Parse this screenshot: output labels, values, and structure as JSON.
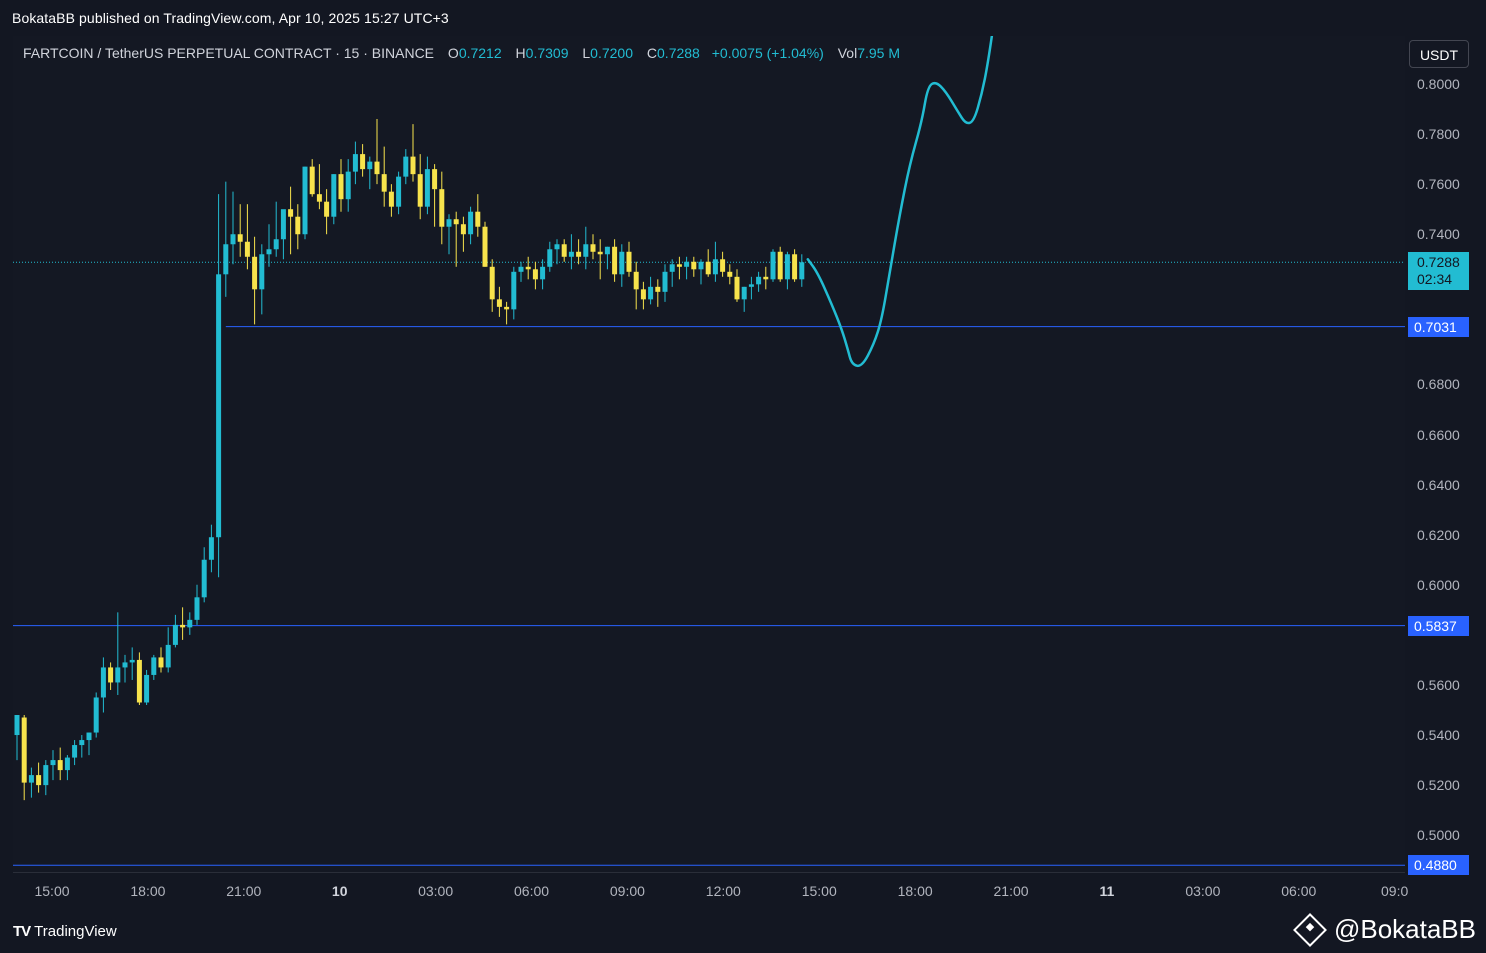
{
  "publisher_line": "BokataBB published on TradingView.com, Apr 10, 2025 15:27 UTC+3",
  "legend": {
    "symbol": "FARTCOIN / TetherUS PERPETUAL CONTRACT · 15 · BINANCE",
    "o_label": "O",
    "o_value": "0.7212",
    "h_label": "H",
    "h_value": "0.7309",
    "l_label": "L",
    "l_value": "0.7200",
    "c_label": "C",
    "c_value": "0.7288",
    "change": "+0.0075 (+1.04%)",
    "vol_label": "Vol",
    "vol_value": "7.95 M"
  },
  "currency": "USDT",
  "current_price": {
    "value": "0.7288",
    "countdown": "02:34"
  },
  "level_tags": [
    "0.7031",
    "0.5837",
    "0.4880"
  ],
  "y_axis_labels": [
    "0.8000",
    "0.7800",
    "0.7600",
    "0.7400",
    "0.6800",
    "0.6600",
    "0.6400",
    "0.6200",
    "0.6000",
    "0.5600",
    "0.5400",
    "0.5200",
    "0.5000"
  ],
  "x_axis_labels": [
    {
      "text": "15:00",
      "bold": false
    },
    {
      "text": "18:00",
      "bold": false
    },
    {
      "text": "21:00",
      "bold": false
    },
    {
      "text": "10",
      "bold": true
    },
    {
      "text": "03:00",
      "bold": false
    },
    {
      "text": "06:00",
      "bold": false
    },
    {
      "text": "09:00",
      "bold": false
    },
    {
      "text": "12:00",
      "bold": false
    },
    {
      "text": "15:00",
      "bold": false
    },
    {
      "text": "18:00",
      "bold": false
    },
    {
      "text": "21:00",
      "bold": false
    },
    {
      "text": "11",
      "bold": true
    },
    {
      "text": "03:00",
      "bold": false
    },
    {
      "text": "06:00",
      "bold": false
    },
    {
      "text": "09:0",
      "bold": false
    }
  ],
  "footer": {
    "brand": "TradingView",
    "watermark": "@BokataBB"
  },
  "colors": {
    "up": "#22bcd2",
    "down": "#f7e34c",
    "level_line": "#2962ff",
    "projection": "#22bcd2",
    "background": "#131722"
  },
  "chart_data": {
    "type": "candlestick",
    "timeframe_minutes": 15,
    "ylim": [
      0.475,
      0.82
    ],
    "levels": [
      {
        "value": 0.7031,
        "from_time": "Apr 9 21:00"
      },
      {
        "value": 0.5837,
        "from_time": "start"
      },
      {
        "value": 0.488,
        "from_time": "start"
      }
    ],
    "current_price": 0.7288,
    "candles_ohlc": [
      [
        0.54,
        0.548,
        0.53,
        0.548
      ],
      [
        0.547,
        0.548,
        0.514,
        0.521
      ],
      [
        0.521,
        0.527,
        0.515,
        0.524
      ],
      [
        0.524,
        0.529,
        0.517,
        0.52
      ],
      [
        0.52,
        0.53,
        0.516,
        0.528
      ],
      [
        0.528,
        0.534,
        0.522,
        0.53
      ],
      [
        0.53,
        0.535,
        0.522,
        0.526
      ],
      [
        0.526,
        0.532,
        0.522,
        0.531
      ],
      [
        0.531,
        0.538,
        0.528,
        0.536
      ],
      [
        0.536,
        0.54,
        0.531,
        0.538
      ],
      [
        0.538,
        0.541,
        0.532,
        0.541
      ],
      [
        0.541,
        0.557,
        0.539,
        0.555
      ],
      [
        0.555,
        0.571,
        0.549,
        0.567
      ],
      [
        0.567,
        0.569,
        0.558,
        0.561
      ],
      [
        0.561,
        0.589,
        0.556,
        0.567
      ],
      [
        0.567,
        0.572,
        0.561,
        0.569
      ],
      [
        0.569,
        0.575,
        0.562,
        0.57
      ],
      [
        0.57,
        0.573,
        0.552,
        0.553
      ],
      [
        0.553,
        0.566,
        0.552,
        0.564
      ],
      [
        0.564,
        0.572,
        0.562,
        0.571
      ],
      [
        0.571,
        0.575,
        0.565,
        0.567
      ],
      [
        0.567,
        0.583,
        0.565,
        0.576
      ],
      [
        0.576,
        0.588,
        0.575,
        0.584
      ],
      [
        0.584,
        0.591,
        0.578,
        0.583
      ],
      [
        0.583,
        0.589,
        0.58,
        0.586
      ],
      [
        0.586,
        0.6,
        0.584,
        0.595
      ],
      [
        0.595,
        0.615,
        0.593,
        0.61
      ],
      [
        0.61,
        0.624,
        0.605,
        0.619
      ],
      [
        0.619,
        0.756,
        0.603,
        0.724
      ],
      [
        0.724,
        0.761,
        0.715,
        0.736
      ],
      [
        0.736,
        0.757,
        0.728,
        0.74
      ],
      [
        0.74,
        0.752,
        0.731,
        0.737
      ],
      [
        0.737,
        0.752,
        0.726,
        0.731
      ],
      [
        0.731,
        0.739,
        0.704,
        0.718
      ],
      [
        0.718,
        0.736,
        0.708,
        0.732
      ],
      [
        0.732,
        0.744,
        0.727,
        0.734
      ],
      [
        0.734,
        0.753,
        0.731,
        0.738
      ],
      [
        0.738,
        0.748,
        0.73,
        0.75
      ],
      [
        0.75,
        0.759,
        0.732,
        0.747
      ],
      [
        0.747,
        0.752,
        0.734,
        0.74
      ],
      [
        0.74,
        0.767,
        0.738,
        0.767
      ],
      [
        0.767,
        0.77,
        0.755,
        0.756
      ],
      [
        0.756,
        0.768,
        0.75,
        0.753
      ],
      [
        0.753,
        0.758,
        0.74,
        0.747
      ],
      [
        0.747,
        0.764,
        0.744,
        0.764
      ],
      [
        0.764,
        0.77,
        0.749,
        0.754
      ],
      [
        0.754,
        0.77,
        0.749,
        0.765
      ],
      [
        0.765,
        0.777,
        0.76,
        0.772
      ],
      [
        0.772,
        0.776,
        0.763,
        0.766
      ],
      [
        0.766,
        0.771,
        0.758,
        0.769
      ],
      [
        0.769,
        0.786,
        0.76,
        0.764
      ],
      [
        0.764,
        0.775,
        0.751,
        0.757
      ],
      [
        0.757,
        0.76,
        0.747,
        0.751
      ],
      [
        0.751,
        0.765,
        0.748,
        0.763
      ],
      [
        0.763,
        0.774,
        0.76,
        0.771
      ],
      [
        0.771,
        0.784,
        0.761,
        0.764
      ],
      [
        0.764,
        0.772,
        0.746,
        0.751
      ],
      [
        0.751,
        0.771,
        0.748,
        0.766
      ],
      [
        0.766,
        0.768,
        0.743,
        0.758
      ],
      [
        0.758,
        0.765,
        0.736,
        0.743
      ],
      [
        0.743,
        0.748,
        0.732,
        0.746
      ],
      [
        0.746,
        0.749,
        0.727,
        0.744
      ],
      [
        0.744,
        0.747,
        0.733,
        0.74
      ],
      [
        0.74,
        0.751,
        0.736,
        0.749
      ],
      [
        0.749,
        0.756,
        0.739,
        0.743
      ],
      [
        0.743,
        0.745,
        0.727,
        0.727
      ],
      [
        0.727,
        0.73,
        0.709,
        0.714
      ],
      [
        0.714,
        0.719,
        0.707,
        0.711
      ],
      [
        0.711,
        0.713,
        0.704,
        0.71
      ],
      [
        0.71,
        0.727,
        0.706,
        0.725
      ],
      [
        0.725,
        0.729,
        0.721,
        0.727
      ],
      [
        0.727,
        0.731,
        0.722,
        0.726
      ],
      [
        0.726,
        0.729,
        0.718,
        0.722
      ],
      [
        0.722,
        0.73,
        0.718,
        0.727
      ],
      [
        0.727,
        0.737,
        0.725,
        0.734
      ],
      [
        0.734,
        0.738,
        0.728,
        0.736
      ],
      [
        0.736,
        0.738,
        0.729,
        0.731
      ],
      [
        0.731,
        0.74,
        0.726,
        0.733
      ],
      [
        0.733,
        0.738,
        0.728,
        0.731
      ],
      [
        0.731,
        0.743,
        0.726,
        0.736
      ],
      [
        0.736,
        0.74,
        0.73,
        0.733
      ],
      [
        0.733,
        0.738,
        0.722,
        0.732
      ],
      [
        0.732,
        0.735,
        0.726,
        0.735
      ],
      [
        0.735,
        0.738,
        0.721,
        0.724
      ],
      [
        0.724,
        0.736,
        0.719,
        0.733
      ],
      [
        0.733,
        0.737,
        0.723,
        0.725
      ],
      [
        0.725,
        0.729,
        0.71,
        0.718
      ],
      [
        0.718,
        0.721,
        0.71,
        0.714
      ],
      [
        0.714,
        0.723,
        0.712,
        0.719
      ],
      [
        0.719,
        0.722,
        0.711,
        0.717
      ],
      [
        0.717,
        0.728,
        0.713,
        0.725
      ],
      [
        0.725,
        0.73,
        0.719,
        0.728
      ],
      [
        0.728,
        0.731,
        0.722,
        0.727
      ],
      [
        0.727,
        0.731,
        0.722,
        0.729
      ],
      [
        0.729,
        0.731,
        0.723,
        0.726
      ],
      [
        0.726,
        0.73,
        0.72,
        0.729
      ],
      [
        0.729,
        0.734,
        0.723,
        0.724
      ],
      [
        0.724,
        0.737,
        0.721,
        0.73
      ],
      [
        0.73,
        0.733,
        0.723,
        0.725
      ],
      [
        0.725,
        0.728,
        0.72,
        0.723
      ],
      [
        0.723,
        0.726,
        0.713,
        0.714
      ],
      [
        0.714,
        0.719,
        0.709,
        0.719
      ],
      [
        0.719,
        0.723,
        0.714,
        0.72
      ],
      [
        0.72,
        0.725,
        0.717,
        0.723
      ],
      [
        0.723,
        0.727,
        0.718,
        0.722
      ],
      [
        0.722,
        0.734,
        0.721,
        0.733
      ],
      [
        0.733,
        0.735,
        0.721,
        0.722
      ],
      [
        0.722,
        0.733,
        0.718,
        0.732
      ],
      [
        0.732,
        0.734,
        0.721,
        0.722
      ],
      [
        0.722,
        0.732,
        0.719,
        0.7288
      ]
    ],
    "projection_path": [
      [
        0,
        0.73
      ],
      [
        5,
        0.7245
      ],
      [
        12,
        0.712
      ],
      [
        17,
        0.702
      ],
      [
        20,
        0.694
      ],
      [
        22,
        0.688
      ],
      [
        27,
        0.687
      ],
      [
        33,
        0.696
      ],
      [
        37,
        0.706
      ],
      [
        41,
        0.725
      ],
      [
        46,
        0.748
      ],
      [
        51,
        0.768
      ],
      [
        57,
        0.785
      ],
      [
        60,
        0.799
      ],
      [
        64,
        0.801
      ],
      [
        69,
        0.797
      ],
      [
        75,
        0.789
      ],
      [
        79,
        0.784
      ],
      [
        83,
        0.785
      ],
      [
        87,
        0.796
      ],
      [
        90,
        0.808
      ],
      [
        94,
        0.83
      ],
      [
        97,
        0.84
      ]
    ]
  }
}
